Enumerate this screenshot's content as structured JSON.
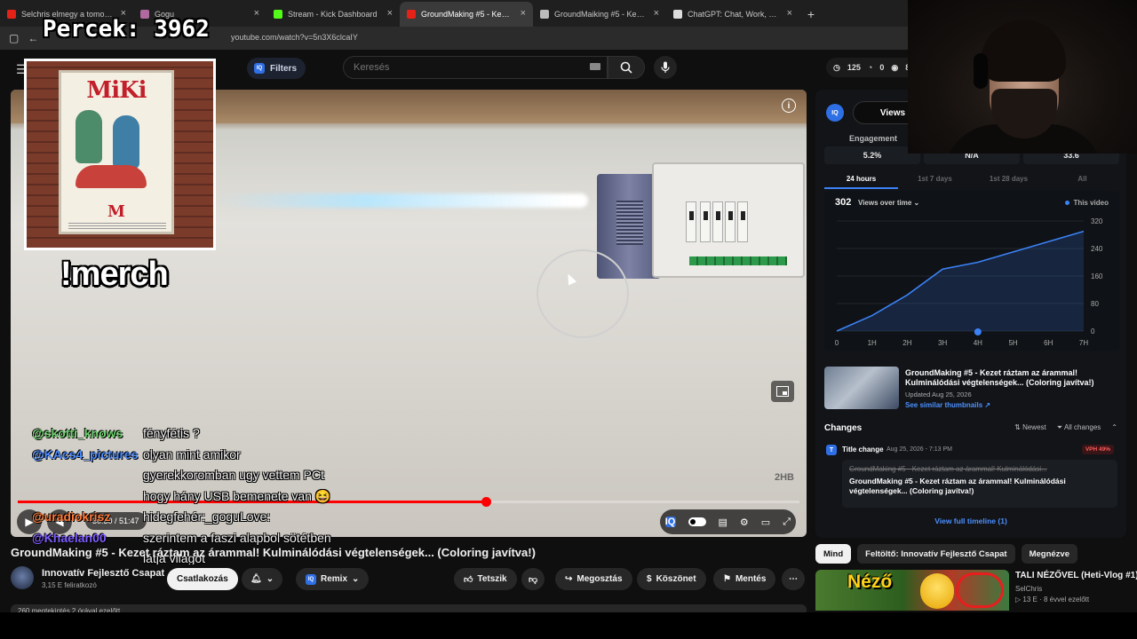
{
  "browser": {
    "tabs": [
      {
        "label": "Selchris elmegy a tomorrowland",
        "fav": "#e62117",
        "active": false
      },
      {
        "label": "Gogu",
        "fav": "#b06aa0",
        "active": false
      },
      {
        "label": "Stream - Kick Dashboard",
        "fav": "#53fc18",
        "active": false
      },
      {
        "label": "GroundMaking #5 - Kezet rázta",
        "fav": "#e62117",
        "active": true
      },
      {
        "label": "GroundMaiking #5 - Kezet rázi",
        "fav": "#bbbbbb",
        "active": false
      },
      {
        "label": "ChatGPT: Chat, Work, Create &",
        "fav": "#dddddd",
        "active": false
      }
    ],
    "url": "youtube.com/watch?v=5n3X6clcaIY"
  },
  "overlay": {
    "counter": "Percek: 3962",
    "merch_label": "!merch",
    "merch_poster_title": "MiKi",
    "chat": [
      {
        "user": "@skotti_knows",
        "color": "#6fd36f",
        "msg": "fényfétis ?"
      },
      {
        "user": "@KAcs4_pictures",
        "color": "#4d8dff",
        "msg": "olyan mint amikor"
      },
      {
        "user": "",
        "color": "",
        "msg": "gyerekkoromban ugy vettem PCt"
      },
      {
        "user": "",
        "color": "",
        "msg": "hogy hány USB bemenete van 😆"
      },
      {
        "user": "@uradiokrisz",
        "color": "#ff7b3a",
        "msg": "hidegfehér:_goguLove:"
      },
      {
        "user": "@Khaelan00",
        "color": "#7d5cff",
        "msg": "szerintem a faszi alapbol sötétben"
      },
      {
        "user": "",
        "color": "",
        "msg": "látja világot"
      }
    ]
  },
  "youtube": {
    "filters_label": "Filters",
    "search_placeholder": "Keresés",
    "stats": {
      "views": "125",
      "likes": "0",
      "watching": "8"
    },
    "player": {
      "time": "30:30 / 51:47",
      "progress": 0.5983,
      "watermark": "2HB"
    },
    "video_title": "GroundMaking #5 - Kezet ráztam az árammal! Kulminálódási végtelenségek... (Coloring javítva!)",
    "channel": {
      "name": "Innovatív Fejlesztő Csapat",
      "subs": "3,15 E feliratkozó"
    },
    "actions": {
      "join": "Csatlakozás",
      "remix": "Remix",
      "like": "Tetszik",
      "share": "Megosztás",
      "thanks": "Köszönet",
      "save": "Mentés"
    },
    "desc_peek": "260 megtekintés  2 órával ezelőtt"
  },
  "iq": {
    "logo": "IQ",
    "views_tab": "Views",
    "engagement_label": "Engagement",
    "metrics": [
      "5.2%",
      "N/A",
      "33.6"
    ],
    "ranges": [
      "24 hours",
      "1st 7 days",
      "1st 28 days",
      "All"
    ],
    "views_count": "302",
    "views_over_time": "Views over time",
    "this_video": "This video",
    "chart_data": {
      "type": "line",
      "x": [
        "0",
        "1H",
        "2H",
        "3H",
        "4H",
        "5H",
        "6H",
        "7H"
      ],
      "y_ticks": [
        0,
        80,
        160,
        240,
        320
      ],
      "ylim": [
        0,
        320
      ],
      "series": [
        {
          "name": "This video",
          "color": "#3b82f6",
          "values": [
            0,
            45,
            105,
            180,
            200,
            230,
            260,
            290
          ]
        }
      ]
    },
    "thumb_title": "GroundMaking #5 - Kezet ráztam az árammal! Kulminálódási végtelenségek... (Coloring javítva!)",
    "thumb_updated": "Updated Aug 25, 2026",
    "see_similar": "See similar thumbnails ↗",
    "changes": {
      "heading": "Changes",
      "newest": "Newest",
      "all_changes": "All changes",
      "item_type": "Title change",
      "item_date": "Aug 25, 2026 - 7:13 PM",
      "vph": "VPH 49%",
      "old_title": "GroundMaking #5 - Kezet ráztam az árammal! Kulminálódási...",
      "new_title": "GroundMaking #5 - Kezet ráztam az árammal! Kulminálódási végtelenségek... (Coloring javítva!)",
      "full_timeline": "View full timeline (1)"
    }
  },
  "chips": [
    "Mind",
    "Feltöltő: Innovatív Fejlesztő Csapat",
    "Megnézve"
  ],
  "recommended": {
    "title": "TALI NÉZŐVEL (Heti-Vlog #1)",
    "channel": "SelChris",
    "meta_views": "13 E",
    "meta_age": "8 évvel ezelőtt",
    "thumb_text": "Néző"
  }
}
